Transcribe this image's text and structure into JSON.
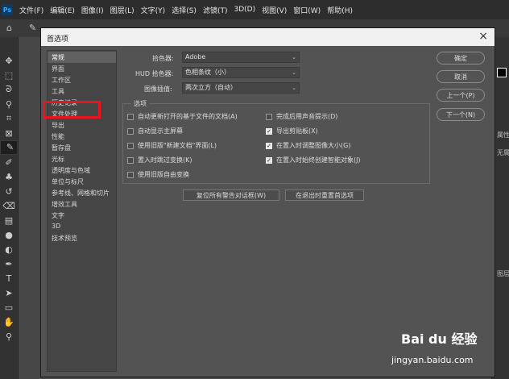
{
  "menubar": {
    "logo": "Ps",
    "items": [
      "文件(F)",
      "编辑(E)",
      "图像(I)",
      "图层(L)",
      "文字(Y)",
      "选择(S)",
      "滤镜(T)",
      "3D(D)",
      "视图(V)",
      "窗口(W)",
      "帮助(H)"
    ]
  },
  "dialog": {
    "title": "首选项",
    "close": "×",
    "nav": [
      "常规",
      "界面",
      "工作区",
      "工具",
      "历史记录",
      "文件处理",
      "导出",
      "性能",
      "暂存盘",
      "光标",
      "透明度与色域",
      "单位与标尺",
      "参考线、网格和切片",
      "增效工具",
      "文字",
      "3D",
      "技术预览"
    ],
    "fields": {
      "color_picker_label": "拾色器:",
      "color_picker_value": "Adobe",
      "hud_label": "HUD 拾色器:",
      "hud_value": "色相条纹（小）",
      "interp_label": "图像插值:",
      "interp_value": "两次立方（自动）"
    },
    "options_title": "选项",
    "options": [
      {
        "label": "自动更新打开的基于文件的文档(A)",
        "checked": false
      },
      {
        "label": "完成后用声音提示(D)",
        "checked": false
      },
      {
        "label": "自动显示主屏幕",
        "checked": false
      },
      {
        "label": "导出剪贴板(X)",
        "checked": true
      },
      {
        "label": "使用旧版\"新建文档\"界面(L)",
        "checked": false
      },
      {
        "label": "在置入时调整图像大小(G)",
        "checked": true
      },
      {
        "label": "置入时跳过变换(K)",
        "checked": false
      },
      {
        "label": "在置入时始终创建智能对象(J)",
        "checked": true
      },
      {
        "label": "使用旧版自由变换",
        "checked": false
      }
    ],
    "reset_warnings": "复位所有警告对话框(W)",
    "reset_on_quit": "在退出时重置首选项",
    "buttons": {
      "ok": "确定",
      "cancel": "取消",
      "prev": "上一个(P)",
      "next": "下一个(N)"
    }
  },
  "right_panel": {
    "label1": "属性",
    "label2": "无属",
    "label3": "图层"
  },
  "watermark": {
    "brand": "Bai du 经验",
    "url": "jingyan.baidu.com"
  }
}
